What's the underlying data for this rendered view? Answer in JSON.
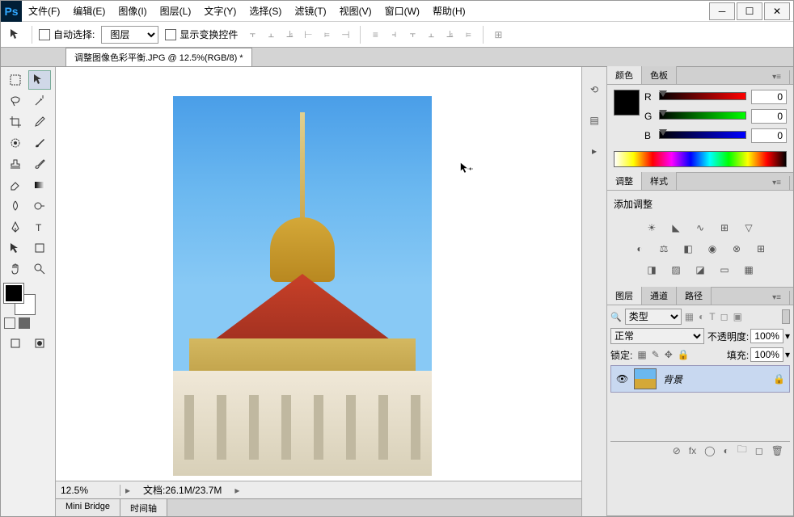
{
  "app": {
    "logo": "Ps"
  },
  "menu": {
    "file": "文件(F)",
    "edit": "编辑(E)",
    "image": "图像(I)",
    "layer": "图层(L)",
    "type": "文字(Y)",
    "select": "选择(S)",
    "filter": "滤镜(T)",
    "view": "视图(V)",
    "window": "窗口(W)",
    "help": "帮助(H)"
  },
  "options": {
    "auto_select": "自动选择:",
    "auto_select_target": "图层",
    "show_transform": "显示变换控件"
  },
  "document": {
    "tab_title": "调整图像色彩平衡.JPG @ 12.5%(RGB/8) *",
    "zoom": "12.5%",
    "status": "文档:26.1M/23.7M"
  },
  "bottom_tabs": {
    "mini_bridge": "Mini Bridge",
    "timeline": "时间轴"
  },
  "panels": {
    "color": {
      "tab_color": "颜色",
      "tab_swatches": "色板",
      "r_label": "R",
      "r_value": "0",
      "g_label": "G",
      "g_value": "0",
      "b_label": "B",
      "b_value": "0"
    },
    "adjustments": {
      "tab_adjust": "调整",
      "tab_styles": "样式",
      "title": "添加调整"
    },
    "layers": {
      "tab_layers": "图层",
      "tab_channels": "通道",
      "tab_paths": "路径",
      "filter_kind": "类型",
      "blend_mode": "正常",
      "opacity_label": "不透明度:",
      "opacity_value": "100%",
      "lock_label": "锁定:",
      "fill_label": "填充:",
      "fill_value": "100%",
      "layer0_name": "背景"
    }
  }
}
